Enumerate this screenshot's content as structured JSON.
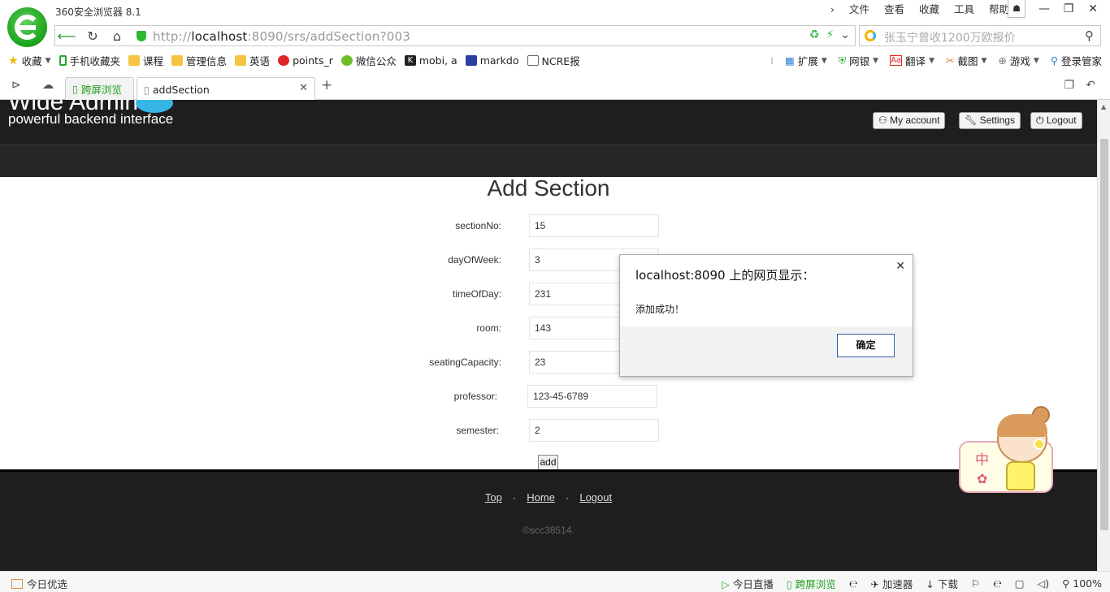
{
  "browser": {
    "title": "360安全浏览器 8.1",
    "menu": [
      "文件",
      "查看",
      "收藏",
      "工具",
      "帮助"
    ],
    "window_controls": {
      "skin": "☗",
      "minimize": "—",
      "maximize": "❐",
      "close": "✕"
    },
    "url_prefix": "http://",
    "url_host": "localhost",
    "url_rest": ":8090/srs/addSection?003",
    "search_placeholder": "张玉宁曾收1200万欧报价",
    "bookmarks": [
      {
        "label": "收藏",
        "icon": "star-icon"
      },
      {
        "label": "手机收藏夹",
        "icon": "phone-icon"
      },
      {
        "label": "课程",
        "icon": "folder-icon"
      },
      {
        "label": "管理信息",
        "icon": "folder-icon"
      },
      {
        "label": "英语",
        "icon": "folder-icon"
      },
      {
        "label": "points_r",
        "icon": "weibo-icon"
      },
      {
        "label": "微信公众",
        "icon": "wechat-icon"
      },
      {
        "label": "mobi, a",
        "icon": "k-icon"
      },
      {
        "label": "markdo",
        "icon": "paw-icon"
      },
      {
        "label": "NCRE报",
        "icon": "ncre-icon"
      }
    ],
    "bookmark_tools": [
      "扩展",
      "网银",
      "翻译",
      "截图",
      "游戏",
      "登录管家"
    ],
    "tabs": [
      {
        "label": "跨屏浏览"
      },
      {
        "label": "addSection"
      }
    ],
    "statusbar": {
      "left": "今日优选",
      "right": [
        "今日直播",
        "跨屏浏览",
        "加速器",
        "下载"
      ],
      "zoom": "100%"
    }
  },
  "site": {
    "logo": "Wide Admin",
    "tagline": "powerful backend interface",
    "header_buttons": [
      "My account",
      "Settings",
      "Logout"
    ],
    "page_title": "Add Section",
    "form": [
      {
        "label": "sectionNo:",
        "value": "15"
      },
      {
        "label": "dayOfWeek:",
        "value": "3"
      },
      {
        "label": "timeOfDay:",
        "value": "231"
      },
      {
        "label": "room:",
        "value": "143"
      },
      {
        "label": "seatingCapacity:",
        "value": "23"
      },
      {
        "label": "professor:",
        "value": "123-45-6789"
      },
      {
        "label": "semester:",
        "value": "2"
      }
    ],
    "submit_label": "add",
    "footer_links": [
      "Top",
      "Home",
      "Logout"
    ],
    "copyright": "©scc38514."
  },
  "dialog": {
    "title": "localhost:8090 上的网页显示：",
    "message": "添加成功！",
    "ok_label": "确定"
  },
  "mascot": {
    "label": "中"
  }
}
